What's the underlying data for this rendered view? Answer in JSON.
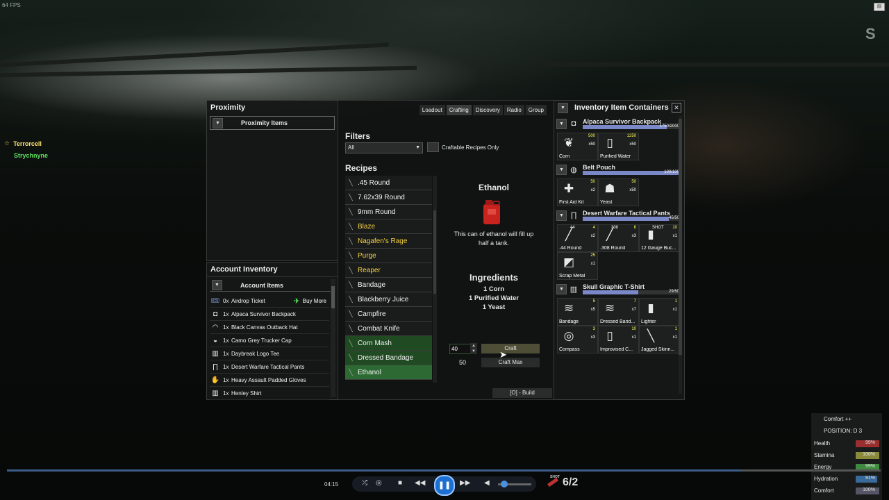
{
  "hud_top": {
    "fps": "64 FPS",
    "compass": "S"
  },
  "players": [
    "Terrorcell",
    "Strychnyne"
  ],
  "proximity": {
    "title": "Proximity",
    "sub": "Proximity Items"
  },
  "account": {
    "title": "Account Inventory",
    "sub": "Account Items",
    "items": [
      {
        "qty": "0x",
        "name": "Airdrop Ticket",
        "icon": "ticket-icon",
        "buy": "Buy More"
      },
      {
        "qty": "1x",
        "name": "Alpaca Survivor Backpack",
        "icon": "backpack-icon"
      },
      {
        "qty": "1x",
        "name": "Black Canvas Outback Hat",
        "icon": "hat-icon"
      },
      {
        "qty": "1x",
        "name": "Camo Grey Trucker Cap",
        "icon": "cap-icon"
      },
      {
        "qty": "1x",
        "name": "Daybreak Logo Tee",
        "icon": "shirt-icon"
      },
      {
        "qty": "1x",
        "name": "Desert Warfare Tactical Pants",
        "icon": "pants-icon"
      },
      {
        "qty": "1x",
        "name": "Heavy Assault Padded Gloves",
        "icon": "gloves-icon"
      },
      {
        "qty": "1x",
        "name": "Henley Shirt",
        "icon": "shirt-icon"
      }
    ]
  },
  "crafting": {
    "tabs": [
      "Loadout",
      "Crafting",
      "Discovery",
      "Radio",
      "Group"
    ],
    "active_tab": "Crafting",
    "filters_title": "Filters",
    "filter_value": "All",
    "craftable_label": "Craftable Recipes Only",
    "recipes_title": "Recipes",
    "recipes": [
      {
        "name": ".45 Round",
        "style": "white"
      },
      {
        "name": "7.62x39 Round",
        "style": "white"
      },
      {
        "name": "9mm Round",
        "style": "white"
      },
      {
        "name": "Blaze",
        "style": "yellow"
      },
      {
        "name": "Nagafen's Rage",
        "style": "yellow"
      },
      {
        "name": "Purge",
        "style": "yellow"
      },
      {
        "name": "Reaper",
        "style": "yellow"
      },
      {
        "name": "Bandage",
        "style": "white"
      },
      {
        "name": "Blackberry Juice",
        "style": "white"
      },
      {
        "name": "Campfire",
        "style": "white"
      },
      {
        "name": "Combat Knife",
        "style": "white"
      },
      {
        "name": "Corn Mash",
        "style": "green"
      },
      {
        "name": "Dressed Bandage",
        "style": "green"
      },
      {
        "name": "Ethanol",
        "style": "selected"
      }
    ],
    "selected": {
      "name": "Ethanol",
      "desc_line1": "This can of ethanol will fill up",
      "desc_line2": "half a tank.",
      "ingredients_title": "Ingredients",
      "ingredients": [
        "1 Corn",
        "1 Purified Water",
        "1 Yeast"
      ]
    },
    "qty_value": "40",
    "max_qty": "50",
    "craft_label": "Craft",
    "craft_max_label": "Craft Max",
    "build_label": "[O] - Build"
  },
  "containers": {
    "title": "Inventory Item Containers",
    "list": [
      {
        "name": "Alpaca Survivor Backpack",
        "cap": "1750/2000",
        "fill": 0.875,
        "icon": "backpack-icon",
        "items": [
          {
            "name": "Corn",
            "top": "500",
            "mult": "x50",
            "icon": "corn-icon"
          },
          {
            "name": "Purified Water",
            "top": "1250",
            "mult": "x50",
            "icon": "water-bottle-icon"
          }
        ]
      },
      {
        "name": "Belt Pouch",
        "cap": "100/100",
        "fill": 1.0,
        "icon": "pouch-icon",
        "items": [
          {
            "name": "First Aid Kit",
            "top": "50",
            "mult": "x2",
            "icon": "first-aid-icon"
          },
          {
            "name": "Yeast",
            "top": "50",
            "mult": "x50",
            "icon": "yeast-sack-icon"
          }
        ]
      },
      {
        "name": "Desert Warfare Tactical Pants",
        "cap": "45/50",
        "fill": 0.9,
        "icon": "pants-icon",
        "items": [
          {
            "name": ".44 Round",
            "top": "4",
            "mult": "x2",
            "label": "44",
            "icon": "bullet-icon"
          },
          {
            "name": ".308 Round",
            "top": "6",
            "mult": "x3",
            "label": "308",
            "icon": "bullet-icon"
          },
          {
            "name": "12 Gauge Buc...",
            "top": "10",
            "mult": "x1",
            "label": "SHOT",
            "icon": "shotgun-shell-icon"
          },
          {
            "name": "Scrap Metal",
            "top": "25",
            "mult": "x1",
            "icon": "scrap-metal-icon"
          }
        ]
      },
      {
        "name": "Skull Graphic T-Shirt",
        "cap": "29/50",
        "fill": 0.58,
        "icon": "shirt-icon",
        "items": [
          {
            "name": "Bandage",
            "top": "5",
            "mult": "x5",
            "icon": "bandage-icon"
          },
          {
            "name": "Dressed Band...",
            "top": "7",
            "mult": "x7",
            "icon": "bandage-icon"
          },
          {
            "name": "Lighter",
            "top": "1",
            "mult": "x1",
            "icon": "lighter-icon"
          },
          {
            "name": "Compass",
            "top": "3",
            "mult": "x3",
            "icon": "compass-icon"
          },
          {
            "name": "Improvised C...",
            "top": "10",
            "mult": "x1",
            "icon": "bottle-icon"
          },
          {
            "name": "Jagged Skinn...",
            "top": "1",
            "mult": "x1",
            "icon": "knife-icon"
          }
        ]
      }
    ]
  },
  "hud": {
    "comfort_pp": "Comfort ++",
    "position": "POSITION: D 3",
    "stats": [
      {
        "label": "Health",
        "value": "99%",
        "fill": 0.99,
        "color": "#9b2f2f"
      },
      {
        "label": "Stamina",
        "value": "100%",
        "fill": 1.0,
        "color": "#8a8a3a"
      },
      {
        "label": "Energy",
        "value": "99%",
        "fill": 0.99,
        "color": "#3f8a3f"
      },
      {
        "label": "Hydration",
        "value": "91%",
        "fill": 0.91,
        "color": "#3a6a9a"
      },
      {
        "label": "Comfort",
        "value": "100%",
        "fill": 1.0,
        "color": "#556"
      }
    ]
  },
  "media": {
    "time": "04:15",
    "ammo": "6/2",
    "ammo_type": "SHOT",
    "progress": 0.84
  }
}
